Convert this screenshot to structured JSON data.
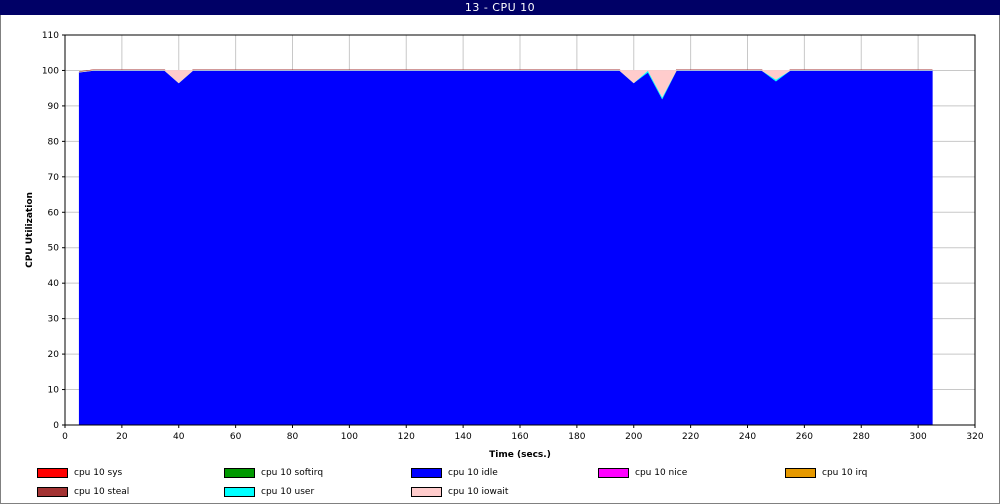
{
  "window": {
    "title": "13 - CPU 10"
  },
  "chart_data": {
    "type": "area",
    "title": "13 - CPU 10",
    "xlabel": "Time (secs.)",
    "ylabel": "CPU Utilization",
    "xlim": [
      0,
      320
    ],
    "ylim": [
      0,
      110
    ],
    "xticks": [
      0,
      20,
      40,
      60,
      80,
      100,
      120,
      140,
      160,
      180,
      200,
      220,
      240,
      260,
      280,
      300,
      320
    ],
    "yticks": [
      0,
      10,
      20,
      30,
      40,
      50,
      60,
      70,
      80,
      90,
      100,
      110
    ],
    "grid": true,
    "stacked": true,
    "legend_position": "bottom",
    "x": [
      5,
      10,
      15,
      20,
      25,
      30,
      35,
      40,
      45,
      50,
      55,
      60,
      65,
      70,
      75,
      80,
      85,
      90,
      95,
      100,
      105,
      110,
      115,
      120,
      125,
      130,
      135,
      140,
      145,
      150,
      155,
      160,
      165,
      170,
      175,
      180,
      185,
      190,
      195,
      200,
      205,
      210,
      215,
      220,
      225,
      230,
      235,
      240,
      245,
      250,
      255,
      260,
      265,
      270,
      275,
      280,
      285,
      290,
      295,
      300,
      305
    ],
    "series": [
      {
        "name": "cpu 10 sys",
        "color": "#ff0000",
        "values": [
          0,
          0,
          0,
          0,
          0,
          0,
          0,
          0,
          0,
          0,
          0,
          0,
          0,
          0,
          0,
          0,
          0,
          0,
          0,
          0,
          0,
          0,
          0,
          0,
          0,
          0,
          0,
          0,
          0,
          0,
          0,
          0,
          0,
          0,
          0,
          0,
          0,
          0,
          0,
          0,
          0,
          0,
          0,
          0,
          0,
          0,
          0,
          0,
          0,
          0,
          0,
          0,
          0,
          0,
          0,
          0,
          0,
          0,
          0,
          0,
          0
        ]
      },
      {
        "name": "cpu 10 softirq",
        "color": "#009900",
        "values": [
          0,
          0,
          0,
          0,
          0,
          0,
          0,
          0,
          0,
          0,
          0,
          0,
          0,
          0,
          0,
          0,
          0,
          0,
          0,
          0,
          0,
          0,
          0,
          0,
          0,
          0,
          0,
          0,
          0,
          0,
          0,
          0,
          0,
          0,
          0,
          0,
          0,
          0,
          0,
          0,
          0,
          0,
          0,
          0,
          0,
          0,
          0,
          0,
          0,
          0,
          0,
          0,
          0,
          0,
          0,
          0,
          0,
          0,
          0,
          0,
          0
        ]
      },
      {
        "name": "cpu 10 idle",
        "color": "#0000ff",
        "values": [
          99.5,
          100,
          100,
          100,
          100,
          100,
          100,
          96.5,
          100,
          100,
          100,
          100,
          100,
          100,
          100,
          100,
          100,
          100,
          100,
          100,
          100,
          100,
          100,
          100,
          100,
          100,
          100,
          100,
          100,
          100,
          100,
          100,
          100,
          100,
          100,
          100,
          100,
          100,
          100,
          96.5,
          99.5,
          92,
          100,
          100,
          100,
          100,
          100,
          100,
          100,
          97,
          100,
          100,
          100,
          100,
          100,
          100,
          100,
          100,
          100,
          100,
          100
        ]
      },
      {
        "name": "cpu 10 nice",
        "color": "#ff00ff",
        "values": [
          0,
          0,
          0,
          0,
          0,
          0,
          0,
          0,
          0,
          0,
          0,
          0,
          0,
          0,
          0,
          0,
          0,
          0,
          0,
          0,
          0,
          0,
          0,
          0,
          0,
          0,
          0,
          0,
          0,
          0,
          0,
          0,
          0,
          0,
          0,
          0,
          0,
          0,
          0,
          0,
          0,
          0,
          0,
          0,
          0,
          0,
          0,
          0,
          0,
          0,
          0,
          0,
          0,
          0,
          0,
          0,
          0,
          0,
          0,
          0,
          0
        ]
      },
      {
        "name": "cpu 10 irq",
        "color": "#e69900",
        "values": [
          0,
          0,
          0,
          0,
          0,
          0,
          0,
          0,
          0,
          0,
          0,
          0,
          0,
          0,
          0,
          0,
          0,
          0,
          0,
          0,
          0,
          0,
          0,
          0,
          0,
          0,
          0,
          0,
          0,
          0,
          0,
          0,
          0,
          0,
          0,
          0,
          0,
          0,
          0,
          0,
          0,
          0,
          0,
          0,
          0,
          0,
          0,
          0,
          0,
          0,
          0,
          0,
          0,
          0,
          0,
          0,
          0,
          0,
          0,
          0,
          0
        ]
      },
      {
        "name": "cpu 10 steal",
        "color": "#a33333",
        "values": [
          0,
          0,
          0,
          0,
          0,
          0,
          0,
          0,
          0,
          0,
          0,
          0,
          0,
          0,
          0,
          0,
          0,
          0,
          0,
          0,
          0,
          0,
          0,
          0,
          0,
          0,
          0,
          0,
          0,
          0,
          0,
          0,
          0,
          0,
          0,
          0,
          0,
          0,
          0,
          0,
          0,
          0,
          0,
          0,
          0,
          0,
          0,
          0,
          0,
          0,
          0,
          0,
          0,
          0,
          0,
          0,
          0,
          0,
          0,
          0,
          0
        ]
      },
      {
        "name": "cpu 10 user",
        "color": "#00ffff",
        "values": [
          0,
          0,
          0,
          0,
          0,
          0,
          0,
          0,
          0,
          0,
          0,
          0,
          0,
          0,
          0,
          0,
          0,
          0,
          0,
          0,
          0,
          0,
          0,
          0,
          0,
          0,
          0,
          0,
          0,
          0,
          0,
          0,
          0,
          0,
          0,
          0,
          0,
          0,
          0,
          0,
          0.5,
          0.5,
          0,
          0,
          0,
          0,
          0,
          0,
          0,
          0.5,
          0,
          0,
          0,
          0,
          0,
          0,
          0,
          0,
          0,
          0,
          0
        ]
      },
      {
        "name": "cpu 10 iowait",
        "color": "#ffcccc",
        "values": [
          0,
          0,
          0,
          0,
          0,
          0,
          0,
          3.5,
          0,
          0,
          0,
          0,
          0,
          0,
          0,
          0,
          0,
          0,
          0,
          0,
          0,
          0,
          0,
          0,
          0,
          0,
          0,
          0,
          0,
          0,
          0,
          0,
          0,
          0,
          0,
          0,
          0,
          0,
          0,
          3.5,
          0,
          7.5,
          0,
          0,
          0,
          0,
          0,
          0,
          0,
          2.5,
          0,
          0,
          0,
          0,
          0,
          0,
          0,
          0,
          0,
          0,
          0
        ]
      }
    ]
  }
}
